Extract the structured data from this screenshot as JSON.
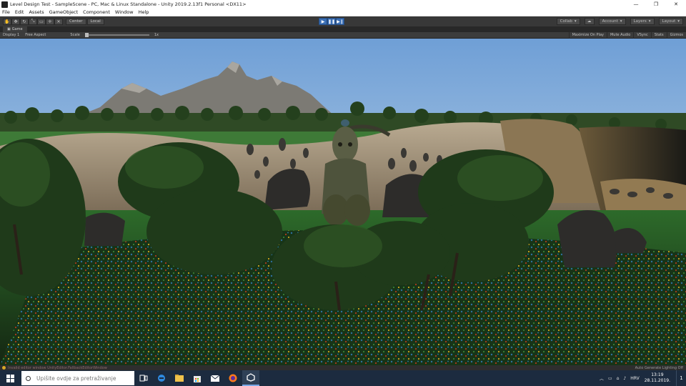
{
  "window": {
    "title": "Level Design Test - SampleScene - PC, Mac & Linux Standalone - Unity 2019.2.13f1 Personal <DX11>",
    "controls": [
      "—",
      "❐",
      "✕"
    ]
  },
  "menu": [
    "File",
    "Edit",
    "Assets",
    "GameObject",
    "Component",
    "Window",
    "Help"
  ],
  "toolbar": {
    "pivot": "Center",
    "space": "Local",
    "account": "Account",
    "layers": "Layers",
    "layout": "Layout",
    "collab": "Collab"
  },
  "game_tab": {
    "label": "Game"
  },
  "game_bar": {
    "display": "Display 1",
    "aspect": "Free Aspect",
    "scale_label": "Scale",
    "scale_value": "1x",
    "scale_level": 0.0,
    "maximize": "Maximize On Play",
    "mute": "Mute Audio",
    "vsync": "VSync",
    "stats": "Stats",
    "gizmos": "Gizmos"
  },
  "status": {
    "message": "Invalid editor window UnityEditor.FallbackEditorWindow",
    "right": "Auto Generate Lighting Off"
  },
  "taskbar": {
    "search_placeholder": "Upišite ovdje za pretraživanje",
    "time": "13:19",
    "date": "28.11.2019.",
    "language": "HRV",
    "notifications": "1"
  },
  "colors": {
    "sky": "#79a9d8",
    "play_blue": "#3b6fb5",
    "taskbar": "#1c2b3f"
  }
}
